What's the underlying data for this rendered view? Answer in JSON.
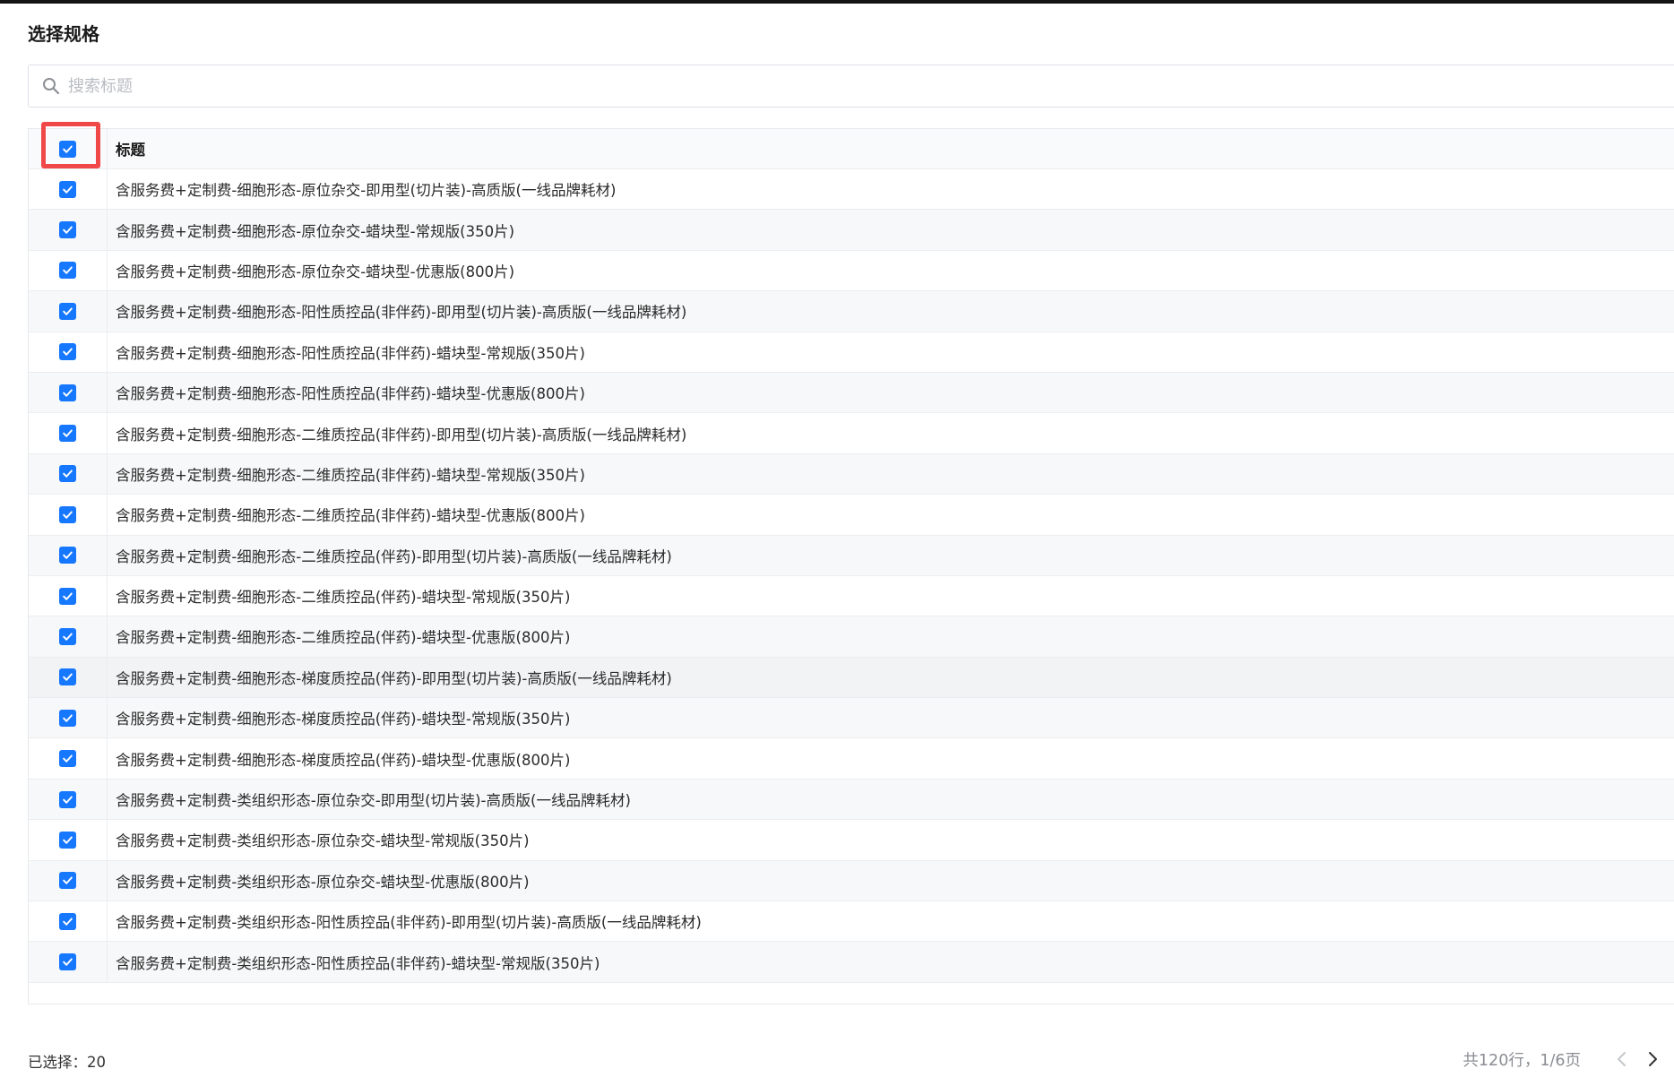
{
  "dialog": {
    "title": "选择规格"
  },
  "search": {
    "placeholder": "搜索标题",
    "value": ""
  },
  "table": {
    "header_title": "标题",
    "select_all_checked": true,
    "rows": [
      {
        "title": "含服务费+定制费-细胞形态-原位杂交-即用型(切片装)-高质版(一线品牌耗材)",
        "checked": true
      },
      {
        "title": "含服务费+定制费-细胞形态-原位杂交-蜡块型-常规版(350片)",
        "checked": true
      },
      {
        "title": "含服务费+定制费-细胞形态-原位杂交-蜡块型-优惠版(800片)",
        "checked": true
      },
      {
        "title": "含服务费+定制费-细胞形态-阳性质控品(非伴药)-即用型(切片装)-高质版(一线品牌耗材)",
        "checked": true
      },
      {
        "title": "含服务费+定制费-细胞形态-阳性质控品(非伴药)-蜡块型-常规版(350片)",
        "checked": true
      },
      {
        "title": "含服务费+定制费-细胞形态-阳性质控品(非伴药)-蜡块型-优惠版(800片)",
        "checked": true
      },
      {
        "title": "含服务费+定制费-细胞形态-二维质控品(非伴药)-即用型(切片装)-高质版(一线品牌耗材)",
        "checked": true
      },
      {
        "title": "含服务费+定制费-细胞形态-二维质控品(非伴药)-蜡块型-常规版(350片)",
        "checked": true
      },
      {
        "title": "含服务费+定制费-细胞形态-二维质控品(非伴药)-蜡块型-优惠版(800片)",
        "checked": true
      },
      {
        "title": "含服务费+定制费-细胞形态-二维质控品(伴药)-即用型(切片装)-高质版(一线品牌耗材)",
        "checked": true
      },
      {
        "title": "含服务费+定制费-细胞形态-二维质控品(伴药)-蜡块型-常规版(350片)",
        "checked": true
      },
      {
        "title": "含服务费+定制费-细胞形态-二维质控品(伴药)-蜡块型-优惠版(800片)",
        "checked": true
      },
      {
        "title": "含服务费+定制费-细胞形态-梯度质控品(伴药)-即用型(切片装)-高质版(一线品牌耗材)",
        "checked": true
      },
      {
        "title": "含服务费+定制费-细胞形态-梯度质控品(伴药)-蜡块型-常规版(350片)",
        "checked": true
      },
      {
        "title": "含服务费+定制费-细胞形态-梯度质控品(伴药)-蜡块型-优惠版(800片)",
        "checked": true
      },
      {
        "title": "含服务费+定制费-类组织形态-原位杂交-即用型(切片装)-高质版(一线品牌耗材)",
        "checked": true
      },
      {
        "title": "含服务费+定制费-类组织形态-原位杂交-蜡块型-常规版(350片)",
        "checked": true
      },
      {
        "title": "含服务费+定制费-类组织形态-原位杂交-蜡块型-优惠版(800片)",
        "checked": true
      },
      {
        "title": "含服务费+定制费-类组织形态-阳性质控品(非伴药)-即用型(切片装)-高质版(一线品牌耗材)",
        "checked": true
      },
      {
        "title": "含服务费+定制费-类组织形态-阳性质控品(非伴药)-蜡块型-常规版(350片)",
        "checked": true
      }
    ]
  },
  "footer": {
    "selected_text": "已选择：20",
    "pager_info": "共120行，1/6页"
  },
  "colors": {
    "accent": "#1677ff",
    "highlight": "#f04848",
    "top_bar": "#141414"
  },
  "icons": {
    "search": "search-icon",
    "check": "check-icon",
    "prev": "chevron-left-icon",
    "next": "chevron-right-icon"
  }
}
